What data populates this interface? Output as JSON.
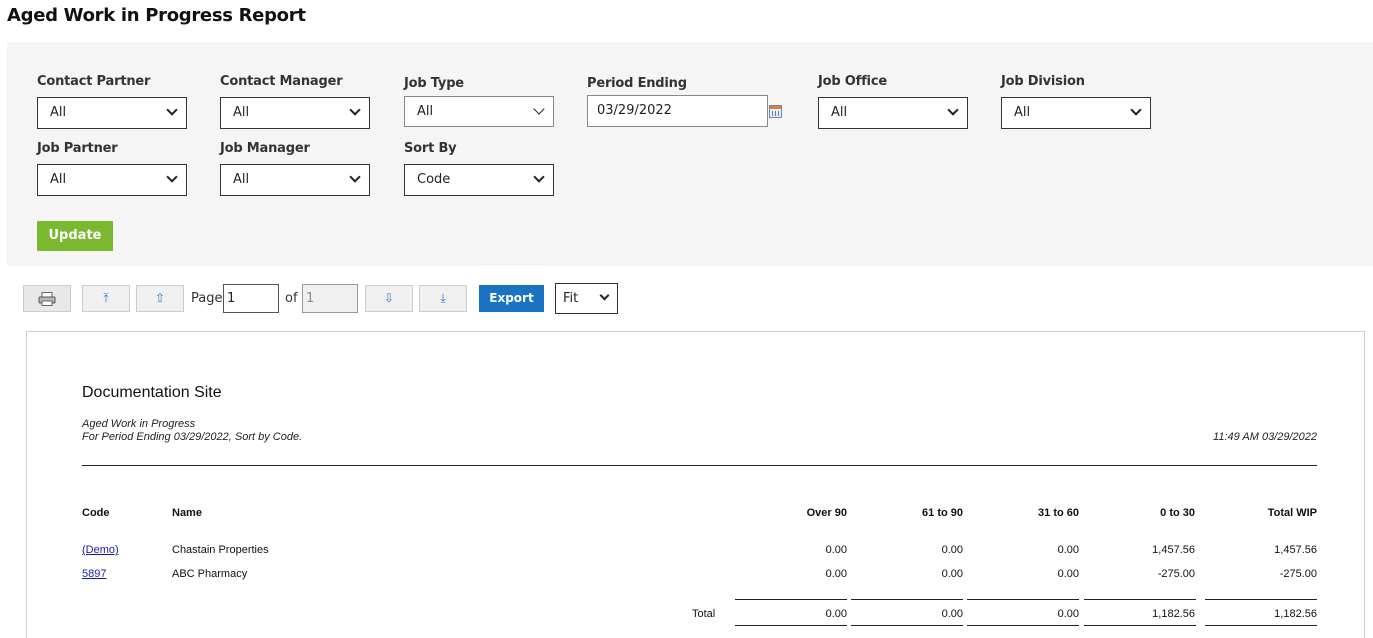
{
  "page": {
    "title": "Aged Work in Progress Report"
  },
  "filters": {
    "contact_partner": {
      "label": "Contact Partner",
      "value": "All"
    },
    "contact_manager": {
      "label": "Contact Manager",
      "value": "All"
    },
    "job_type": {
      "label": "Job Type",
      "value": "All"
    },
    "period_ending": {
      "label": "Period Ending",
      "value": "03/29/2022"
    },
    "job_office": {
      "label": "Job Office",
      "value": "All"
    },
    "job_division": {
      "label": "Job Division",
      "value": "All"
    },
    "job_partner": {
      "label": "Job Partner",
      "value": "All"
    },
    "job_manager": {
      "label": "Job Manager",
      "value": "All"
    },
    "sort_by": {
      "label": "Sort By",
      "value": "Code"
    },
    "update_label": "Update"
  },
  "toolbar": {
    "page_label": "Page",
    "page_value": "1",
    "of_label": "of",
    "total_pages": "1",
    "export_label": "Export",
    "zoom_value": "Fit",
    "icons": {
      "first": "⤒",
      "prev": "⇧",
      "next": "⇩",
      "last": "⤓"
    }
  },
  "report": {
    "site": "Documentation Site",
    "subtitle_1": "Aged Work in Progress",
    "subtitle_2": "For Period Ending 03/29/2022, Sort by Code.",
    "timestamp": "11:49 AM 03/29/2022",
    "columns": [
      "Code",
      "Name",
      "Over 90",
      "61 to 90",
      "31 to 60",
      "0 to 30",
      "Total WIP"
    ],
    "rows": [
      {
        "code": "(Demo)",
        "name": "Chastain Properties",
        "over90": "0.00",
        "d61_90": "0.00",
        "d31_60": "0.00",
        "d0_30": "1,457.56",
        "total": "1,457.56"
      },
      {
        "code": "5897",
        "name": "ABC Pharmacy",
        "over90": "0.00",
        "d61_90": "0.00",
        "d31_60": "0.00",
        "d0_30": "-275.00",
        "total": "-275.00"
      }
    ],
    "totals": {
      "label": "Total",
      "over90": "0.00",
      "d61_90": "0.00",
      "d31_60": "0.00",
      "d0_30": "1,182.56",
      "total": "1,182.56"
    }
  }
}
